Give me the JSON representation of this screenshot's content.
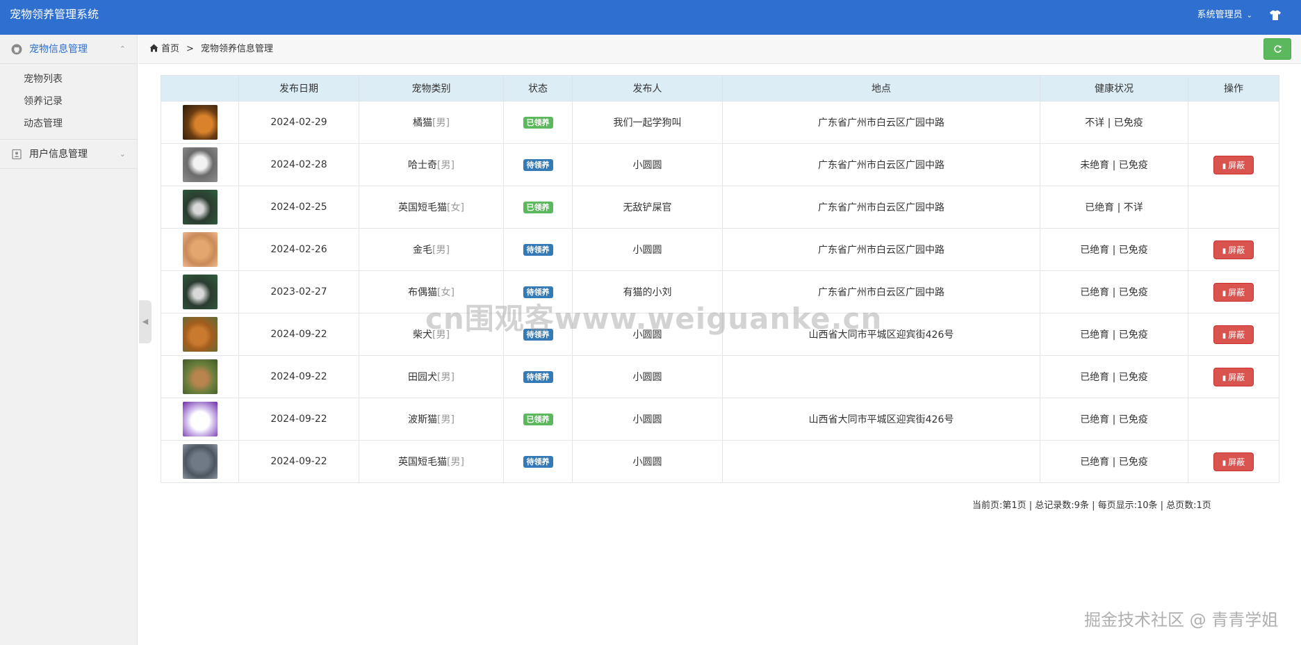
{
  "app": {
    "title": "宠物领养管理系统",
    "user": "系统管理员"
  },
  "sidebar": {
    "menus": [
      {
        "label": "宠物信息管理",
        "items": [
          "宠物列表",
          "领养记录",
          "动态管理"
        ]
      },
      {
        "label": "用户信息管理",
        "items": []
      }
    ]
  },
  "breadcrumb": {
    "home": "首页",
    "separator": ">",
    "current": "宠物领养信息管理"
  },
  "table": {
    "headers": [
      "",
      "发布日期",
      "宠物类别",
      "状态",
      "发布人",
      "地点",
      "健康状况",
      "操作"
    ],
    "rows": [
      {
        "thumb": "orange-cat-photo",
        "date": "2024-02-29",
        "type": "橘猫",
        "gender": "[男]",
        "status": "已领养",
        "status_color": "#5cb85c",
        "publisher": "我们一起学狗叫",
        "location": "广东省广州市白云区广园中路",
        "health": "不详 | 已免疫",
        "action": ""
      },
      {
        "thumb": "husky-dog-photo",
        "date": "2024-02-28",
        "type": "哈士奇",
        "gender": "[男]",
        "status": "待领养",
        "status_color": "#337ab7",
        "publisher": "小圆圆",
        "location": "广东省广州市白云区广园中路",
        "health": "未绝育 | 已免疫",
        "action": "屏蔽"
      },
      {
        "thumb": "british-shorthair-photo",
        "date": "2024-02-25",
        "type": "英国短毛猫",
        "gender": "[女]",
        "status": "已领养",
        "status_color": "#5cb85c",
        "publisher": "无敌铲屎官",
        "location": "广东省广州市白云区广园中路",
        "health": "已绝育 | 不详",
        "action": ""
      },
      {
        "thumb": "golden-retriever-photo",
        "date": "2024-02-26",
        "type": "金毛",
        "gender": "[男]",
        "status": "待领养",
        "status_color": "#337ab7",
        "publisher": "小圆圆",
        "location": "广东省广州市白云区广园中路",
        "health": "已绝育 | 已免疫",
        "action": "屏蔽"
      },
      {
        "thumb": "ragdoll-cat-photo",
        "date": "2023-02-27",
        "type": "布偶猫",
        "gender": "[女]",
        "status": "待领养",
        "status_color": "#337ab7",
        "publisher": "有猫的小刘",
        "location": "广东省广州市白云区广园中路",
        "health": "已绝育 | 已免疫",
        "action": "屏蔽"
      },
      {
        "thumb": "shiba-dog-photo",
        "date": "2024-09-22",
        "type": "柴犬",
        "gender": "[男]",
        "status": "待领养",
        "status_color": "#337ab7",
        "publisher": "小圆圆",
        "location": "山西省大同市平城区迎宾街426号",
        "health": "已绝育 | 已免疫",
        "action": "屏蔽"
      },
      {
        "thumb": "field-dog-photo",
        "date": "2024-09-22",
        "type": "田园犬",
        "gender": "[男]",
        "status": "待领养",
        "status_color": "#337ab7",
        "publisher": "小圆圆",
        "location": "",
        "health": "已绝育 | 已免疫",
        "action": "屏蔽"
      },
      {
        "thumb": "persian-cat-photo",
        "date": "2024-09-22",
        "type": "波斯猫",
        "gender": "[男]",
        "status": "已领养",
        "status_color": "#5cb85c",
        "publisher": "小圆圆",
        "location": "山西省大同市平城区迎宾街426号",
        "health": "已绝育 | 已免疫",
        "action": ""
      },
      {
        "thumb": "blue-shorthair-photo",
        "date": "2024-09-22",
        "type": "英国短毛猫",
        "gender": "[男]",
        "status": "待领养",
        "status_color": "#337ab7",
        "publisher": "小圆圆",
        "location": "",
        "health": "已绝育 | 已免疫",
        "action": "屏蔽"
      }
    ]
  },
  "pager": {
    "text": "当前页:第1页 | 总记录数:9条 | 每页显示:10条 | 总页数:1页"
  },
  "watermarks": {
    "center": "cn围观客www.weiguanke.cn",
    "corner": "掘金技术社区 @ 青青学姐"
  }
}
